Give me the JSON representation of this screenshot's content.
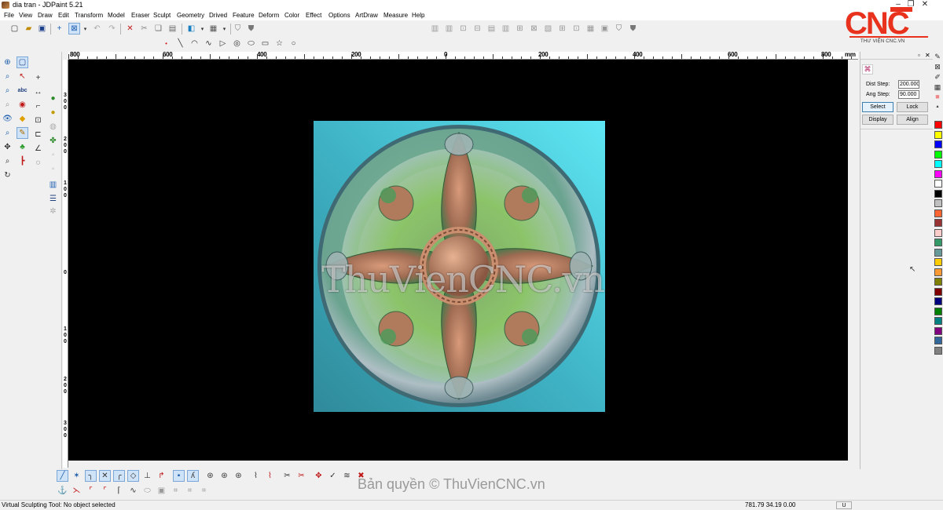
{
  "window": {
    "title": "dia tran - JDPaint 5.21"
  },
  "menu": [
    "File",
    "View",
    "Draw",
    "Edit",
    "Transform",
    "Model",
    "Eraser",
    "Sculpt",
    "Geometry",
    "Drived",
    "Feature",
    "Deform",
    "Color",
    "Effect",
    "Options",
    "ArtDraw",
    "Measure",
    "Help"
  ],
  "ruler": {
    "labels": [
      "800",
      "600",
      "400",
      "200",
      "0",
      "200",
      "400",
      "600",
      "800"
    ],
    "unit": "mm"
  },
  "canvas": {
    "watermark": "ThuVienCNC.vn"
  },
  "panel": {
    "dist_step_label": "Dist Step:",
    "dist_step_value": "200.000",
    "ang_step_label": "Ang Step:",
    "ang_step_value": "90.000",
    "select_label": "Select",
    "lock_label": "Lock",
    "display_label": "Display",
    "align_label": "Align"
  },
  "palette": [
    "#ff0000",
    "#ffff00",
    "#0000ff",
    "#00ff00",
    "#00ffff",
    "#ff00ff",
    "#ffffff",
    "#000000",
    "#c0c0c0",
    "#ff6633",
    "#993333",
    "#ffcccc",
    "#339966",
    "#669999",
    "#ffcc00",
    "#ff9933",
    "#808000",
    "#800000",
    "#000080",
    "#008000",
    "#008080",
    "#800080",
    "#336699",
    "#808080"
  ],
  "logo": {
    "text": "CNC",
    "subtitle": "THƯ VIỆN CNC.VN",
    "color": "#e8321d"
  },
  "copyright": "Bản quyền © ThuVienCNC.vn",
  "status": {
    "message": "Virtual Sculpting Tool: No object selected",
    "coords": "781.79 34.19 0.00",
    "mode": "U"
  }
}
